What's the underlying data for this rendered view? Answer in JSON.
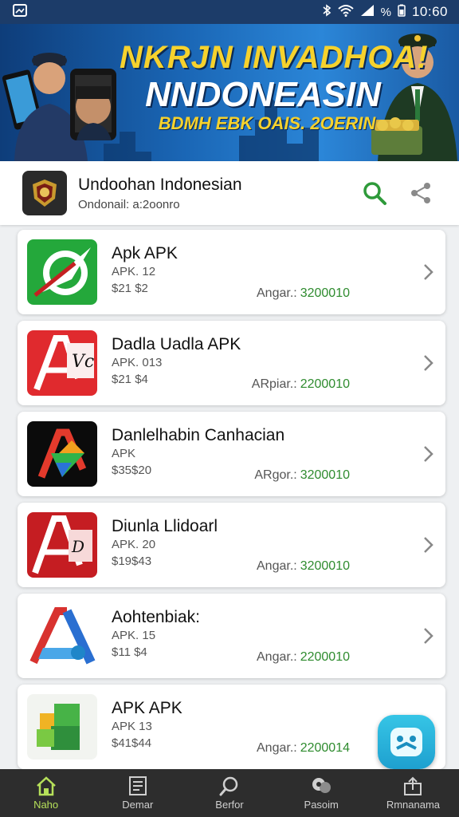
{
  "status_bar": {
    "time": "10:60",
    "battery": "%"
  },
  "banner": {
    "line1": "NKRJN INVADHOA!",
    "line2": "NNDONEASIN",
    "line3": "BDMH EBK OAIS. 2OERIN"
  },
  "header": {
    "app_name": "Undoohan Indonesian",
    "subtitle": "Ondonail: a:2oonro"
  },
  "apps": [
    {
      "title": "Apk APK",
      "version": "APK. 12",
      "size": "$21 $2",
      "price_label": "Angar.:",
      "price_value": "3200010"
    },
    {
      "title": "Dadla Uadla APK",
      "version": "APK. 013",
      "size": "$21 $4",
      "price_label": "ARpiar.:",
      "price_value": "2200010"
    },
    {
      "title": "Danlelhabin Canhacian",
      "version": "APK",
      "size": "$35$20",
      "price_label": "ARgor.:",
      "price_value": "3200010"
    },
    {
      "title": "Diunla Llidoarl",
      "version": "APK. 20",
      "size": "$19$43",
      "price_label": "Angar.:",
      "price_value": "3200010"
    },
    {
      "title": "Aohtenbiak:",
      "version": "APK. 15",
      "size": "$11 $4",
      "price_label": "Angar.:",
      "price_value": "2200010"
    },
    {
      "title": "APK APK",
      "version": "APK 13",
      "size": "$41$44",
      "price_label": "Angar.:",
      "price_value": "2200014"
    }
  ],
  "nav": [
    {
      "label": "Naho",
      "icon": "home-icon"
    },
    {
      "label": "Demar",
      "icon": "document-icon"
    },
    {
      "label": "Berfor",
      "icon": "search-icon"
    },
    {
      "label": "Pasoim",
      "icon": "chat-icon"
    },
    {
      "label": "Rmnanama",
      "icon": "upload-icon"
    }
  ],
  "colors": {
    "status_bar": "#1c3c69",
    "accent_green": "#2e8b2e",
    "nav_bg": "#2d2d2d",
    "nav_active": "#b6e05a"
  }
}
